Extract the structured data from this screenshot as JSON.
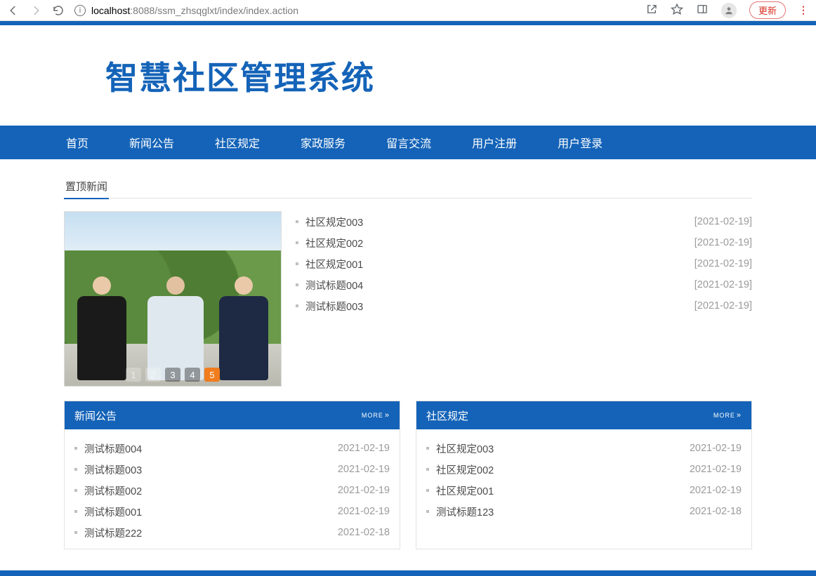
{
  "browser": {
    "url_host": "localhost",
    "url_port": ":8088",
    "url_path": "/ssm_zhsqglxt/index/index.action",
    "update_label": "更新"
  },
  "site": {
    "title": "智慧社区管理系统"
  },
  "nav": {
    "items": [
      "首页",
      "新闻公告",
      "社区规定",
      "家政服务",
      "留言交流",
      "用户注册",
      "用户登录"
    ]
  },
  "sections": {
    "top_news_tab": "置顶新闻"
  },
  "carousel": {
    "pages": [
      "1",
      "2",
      "3",
      "4",
      "5"
    ],
    "active_index": 4
  },
  "featured": [
    {
      "title": "社区规定003",
      "date": "[2021-02-19]"
    },
    {
      "title": "社区规定002",
      "date": "[2021-02-19]"
    },
    {
      "title": "社区规定001",
      "date": "[2021-02-19]"
    },
    {
      "title": "测试标题004",
      "date": "[2021-02-19]"
    },
    {
      "title": "测试标题003",
      "date": "[2021-02-19]"
    }
  ],
  "panels": {
    "news": {
      "title": "新闻公告",
      "more": "MORE",
      "items": [
        {
          "title": "测试标题004",
          "date": "2021-02-19"
        },
        {
          "title": "测试标题003",
          "date": "2021-02-19"
        },
        {
          "title": "测试标题002",
          "date": "2021-02-19"
        },
        {
          "title": "测试标题001",
          "date": "2021-02-19"
        },
        {
          "title": "测试标题222",
          "date": "2021-02-18"
        }
      ]
    },
    "rules": {
      "title": "社区规定",
      "more": "MORE",
      "items": [
        {
          "title": "社区规定003",
          "date": "2021-02-19"
        },
        {
          "title": "社区规定002",
          "date": "2021-02-19"
        },
        {
          "title": "社区规定001",
          "date": "2021-02-19"
        },
        {
          "title": "测试标题123",
          "date": "2021-02-18"
        }
      ]
    }
  }
}
